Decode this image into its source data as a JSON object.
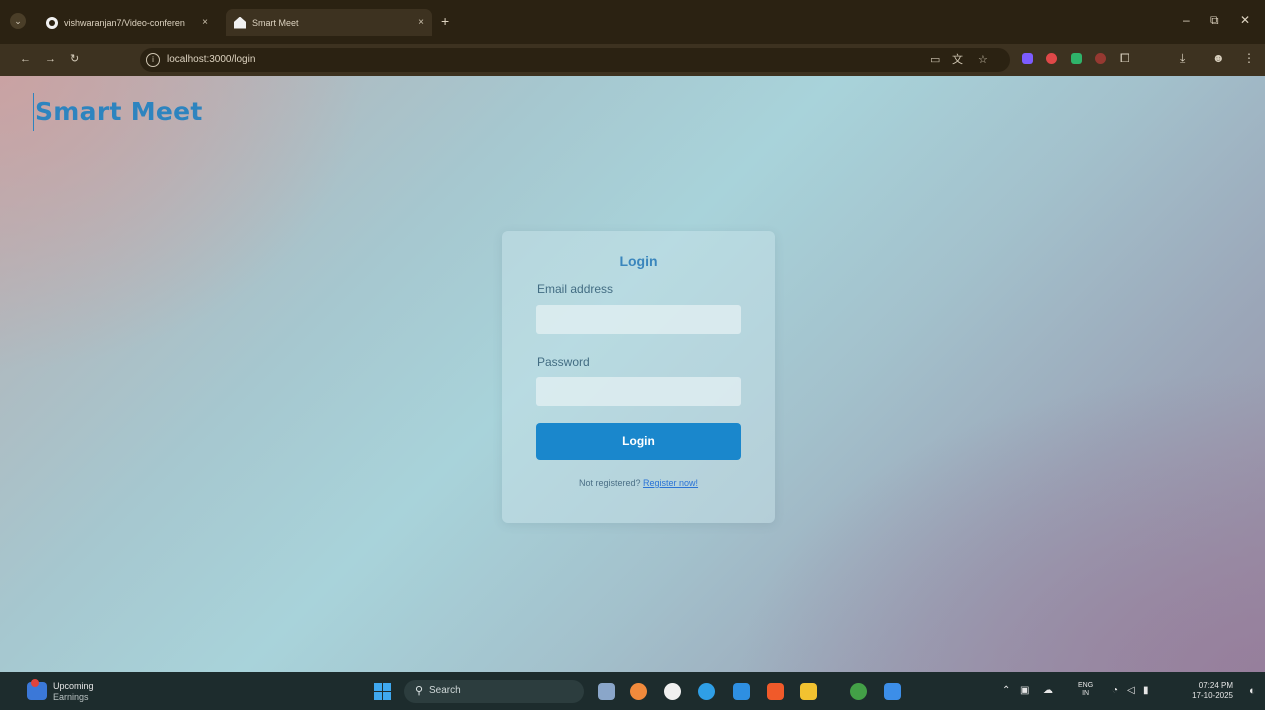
{
  "browser": {
    "tabs": [
      {
        "title": "vishwaranjan7/Video-conferen",
        "favicon": "github-icon",
        "close": "×"
      },
      {
        "title": "Smart Meet",
        "favicon": "home-icon",
        "close": "×"
      }
    ],
    "new_tab": "+",
    "window_controls": {
      "minimize": "–",
      "maximize": "⧉",
      "close": "✕"
    },
    "nav": {
      "back": "←",
      "forward": "→",
      "reload": "↻"
    },
    "url": "localhost:3000/login",
    "omnibox_icons": [
      "cast-icon",
      "translate-icon",
      "star-icon"
    ],
    "toolbar_icons": {
      "sidebar": "⧠",
      "download": "⤓",
      "profile": "☻",
      "menu": "⋮"
    },
    "extension_colors": [
      "#7c5cff",
      "#e04848",
      "#2fb36a",
      "#d23d3d"
    ]
  },
  "page": {
    "brand": "Smart Meet",
    "login": {
      "title": "Login",
      "email_label": "Email address",
      "email_value": "",
      "password_label": "Password",
      "password_value": "",
      "button": "Login",
      "register_prompt": "Not registered?",
      "register_link": "Register now!"
    }
  },
  "taskbar": {
    "widget": {
      "title": "Upcoming",
      "subtitle": "Earnings"
    },
    "search_placeholder": "Search",
    "pinned_apps": [
      "file-explorer-icon",
      "copilot-icon",
      "github-desktop-icon",
      "edge-icon",
      "vscode-icon",
      "brave-icon",
      "folder-icon",
      "chrome-icon",
      "app-icon"
    ],
    "app_colors": [
      "#8aa6c9",
      "#f08a3c",
      "#f0f0f0",
      "#2f9fe6",
      "#2e8fe2",
      "#f05a2a",
      "#f2c230",
      "#43a047",
      "#3c8ee8"
    ],
    "tray": {
      "lang_top": "ENG",
      "lang_bottom": "IN",
      "time": "07:24 PM",
      "date": "17-10-2025"
    }
  },
  "colors": {
    "brand": "#2d84bf",
    "button": "#1a87cc",
    "link": "#2a73d6"
  }
}
